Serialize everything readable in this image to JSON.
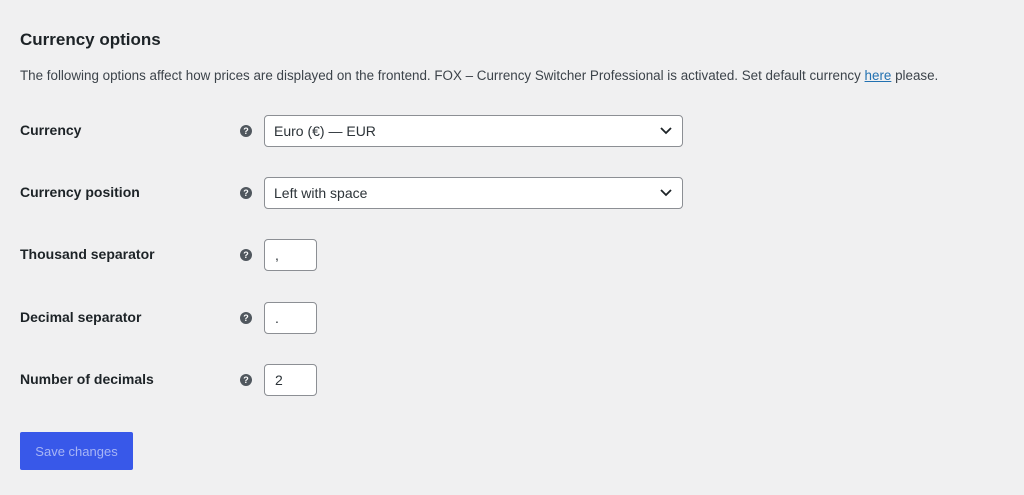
{
  "section": {
    "title": "Currency options",
    "description_prefix": "The following options affect how prices are displayed on the frontend. FOX – Currency Switcher Professional is activated. Set default currency ",
    "description_link": "here",
    "description_suffix": " please."
  },
  "help_glyph": "?",
  "fields": {
    "currency": {
      "label": "Currency",
      "value": "Euro (€) — EUR"
    },
    "currency_position": {
      "label": "Currency position",
      "value": "Left with space"
    },
    "thousand_separator": {
      "label": "Thousand separator",
      "value": ","
    },
    "decimal_separator": {
      "label": "Decimal separator",
      "value": "."
    },
    "number_of_decimals": {
      "label": "Number of decimals",
      "value": "2"
    }
  },
  "save_button": {
    "label": "Save changes"
  },
  "colors": {
    "background": "#f0f0f1",
    "accent": "#3858e9",
    "link": "#2271b1"
  },
  "icons": {
    "help": "help-icon",
    "dropdown": "chevron-down-icon"
  }
}
